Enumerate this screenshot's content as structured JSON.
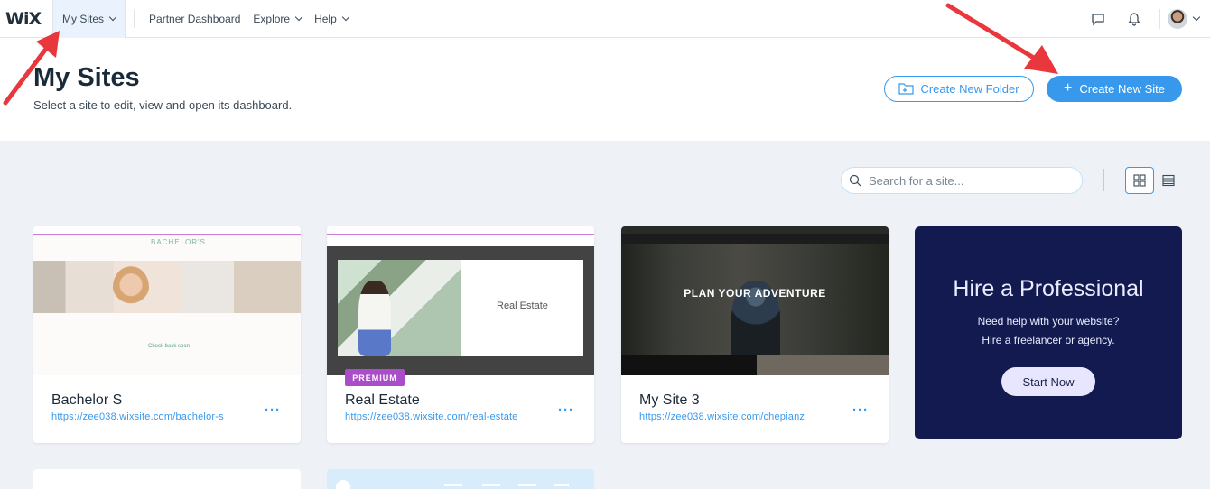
{
  "topbar": {
    "logo": "WiX",
    "nav": [
      {
        "label": "My Sites"
      },
      {
        "label": "Partner Dashboard"
      },
      {
        "label": "Explore"
      },
      {
        "label": "Help"
      }
    ]
  },
  "header": {
    "title": "My Sites",
    "subtitle": "Select a site to edit, view and open its dashboard.",
    "create_folder_label": "Create New Folder",
    "create_site_label": "Create New Site"
  },
  "search": {
    "placeholder": "Search for a site..."
  },
  "sites": [
    {
      "name": "Bachelor S",
      "url": "https://zee038.wixsite.com/bachelor-s",
      "thumb_brand": "BACHELOR'S",
      "thumb_cta": "Check back soon"
    },
    {
      "name": "Real Estate",
      "url": "https://zee038.wixsite.com/real-estate",
      "badge": "PREMIUM",
      "thumb_title": "Real Estate"
    },
    {
      "name": "My Site 3",
      "url": "https://zee038.wixsite.com/chepianz",
      "thumb_headline": "PLAN YOUR ADVENTURE"
    }
  ],
  "hire": {
    "title": "Hire a Professional",
    "line1": "Need help with your website?",
    "line2": "Hire a freelancer or agency.",
    "button": "Start Now"
  },
  "colors": {
    "accent": "#3899ec",
    "premium": "#aa4dc8",
    "hire_bg": "#121a4f",
    "annotation_arrow": "#e8383d"
  }
}
